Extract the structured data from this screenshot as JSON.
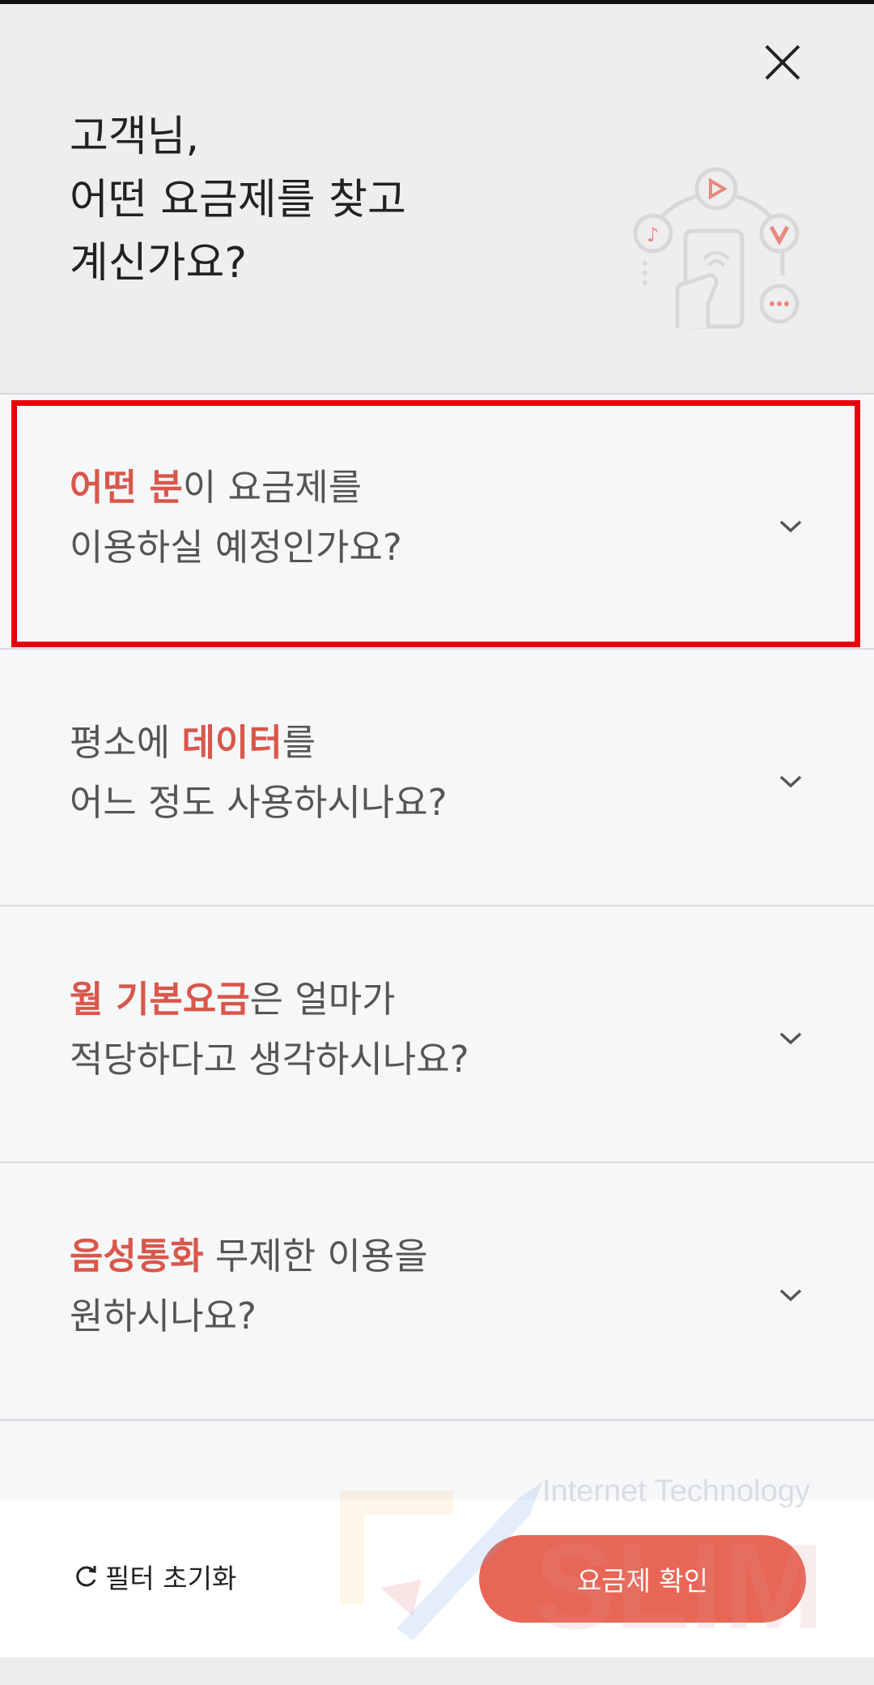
{
  "header": {
    "greeting_line1": "고객님,",
    "greeting_line2": "어떤 요금제를 찾고",
    "greeting_line3": "계신가요?",
    "close_icon": "close-icon",
    "illustration_icon": "phone-media-icon"
  },
  "questions": [
    {
      "highlight": "어떤 분",
      "rest1": "이 요금제를",
      "line2": "이용하실 예정인가요?"
    },
    {
      "pre": "평소에 ",
      "highlight": "데이터",
      "rest1": "를",
      "line2": "어느 정도 사용하시나요?"
    },
    {
      "highlight": "월 기본요금",
      "rest1": "은 얼마가",
      "line2": "적당하다고 생각하시나요?"
    },
    {
      "highlight": "음성통화",
      "rest1": " 무제한 이용을",
      "line2": "원하시나요?"
    }
  ],
  "footer": {
    "reset_label": "필터 초기화",
    "confirm_label": "요금제 확인"
  },
  "watermark": {
    "text": "Internet Technology",
    "brand": "SLIM"
  },
  "colors": {
    "accent": "#d9574b",
    "button": "#e86656",
    "highlight_frame": "#e8000b"
  }
}
